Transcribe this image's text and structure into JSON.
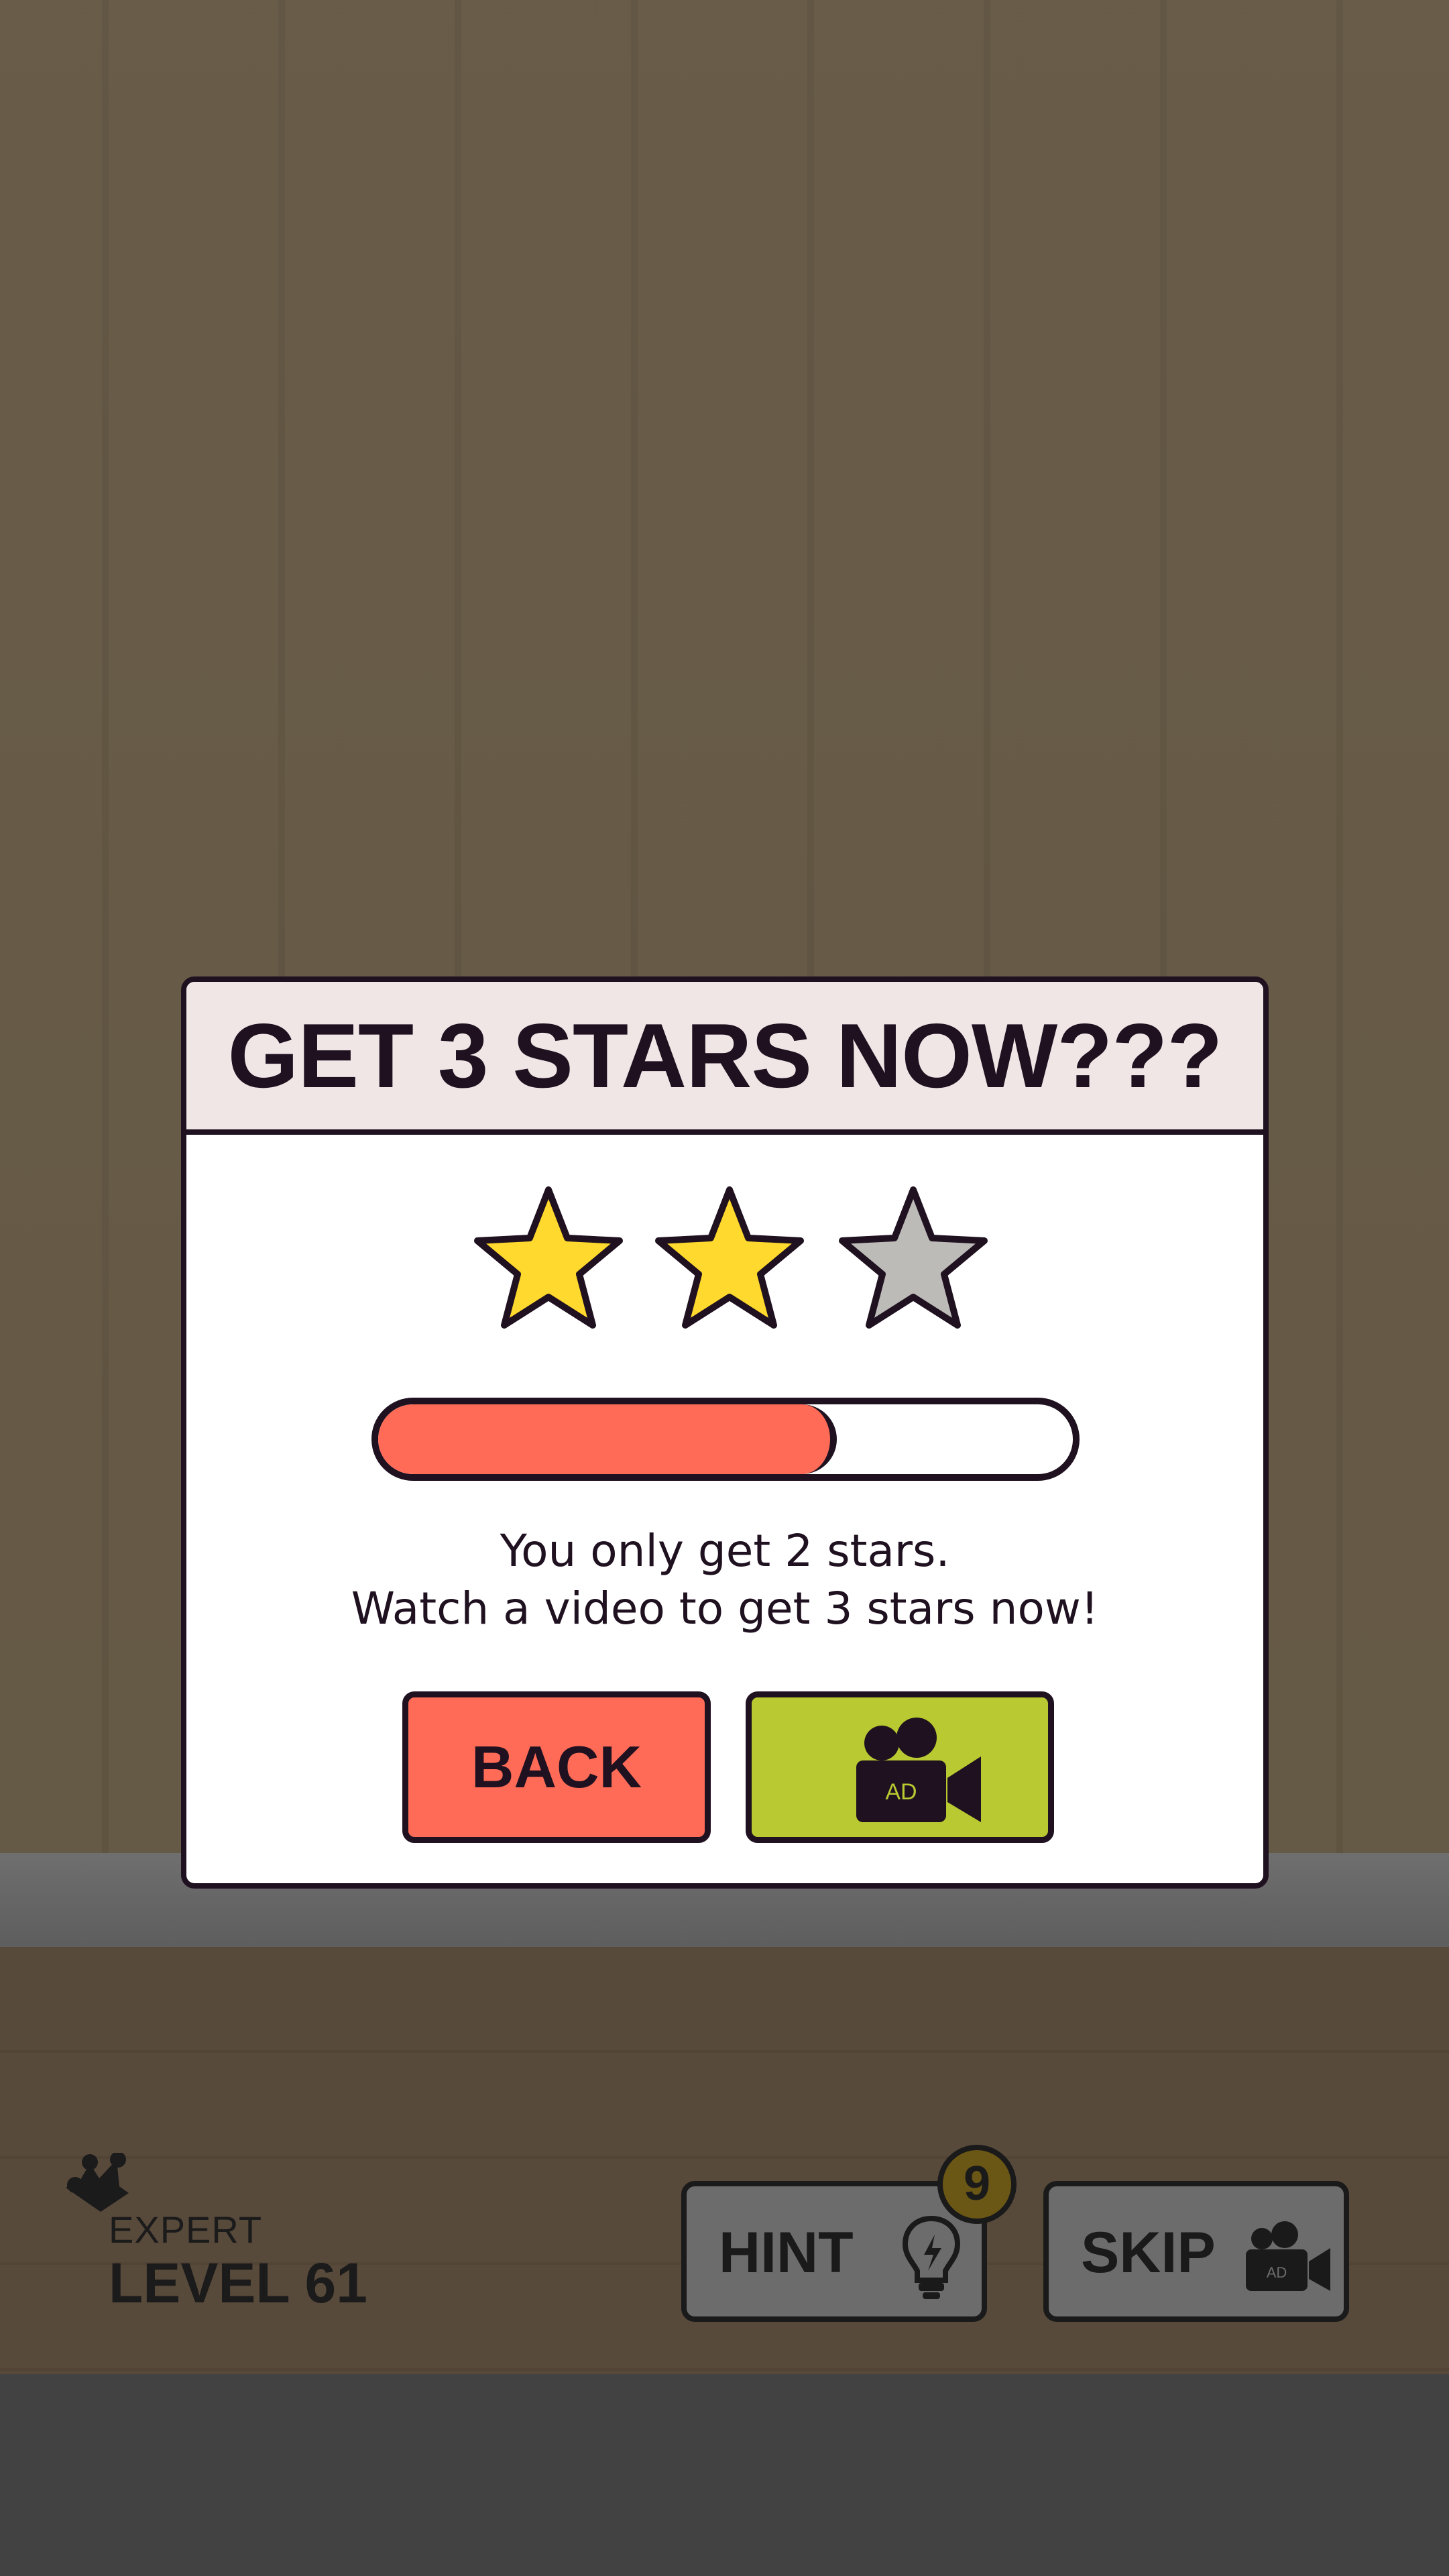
{
  "dialog": {
    "title": "GET 3 STARS NOW???",
    "stars_earned": 2,
    "stars_total": 3,
    "progress_fraction": 0.66,
    "message_line1": "You only get 2 stars.",
    "message_line2": "Watch a video to get 3 stars now!",
    "back_label": "BACK",
    "ad_label": "AD"
  },
  "hud": {
    "difficulty": "EXPERT",
    "level": "LEVEL 61",
    "hint_label": "HINT",
    "hint_count": "9",
    "skip_label": "SKIP",
    "skip_ad_label": "AD"
  },
  "colors": {
    "star_filled": "#ffd92d",
    "star_empty": "#bdbbb8",
    "progress_fill": "#ff6b57",
    "back_button": "#ff6b57",
    "ad_button": "#b8c931",
    "outline": "#1f1120"
  },
  "icons": [
    "crown-icon",
    "lightbulb-icon",
    "video-camera-icon",
    "star-icon"
  ]
}
